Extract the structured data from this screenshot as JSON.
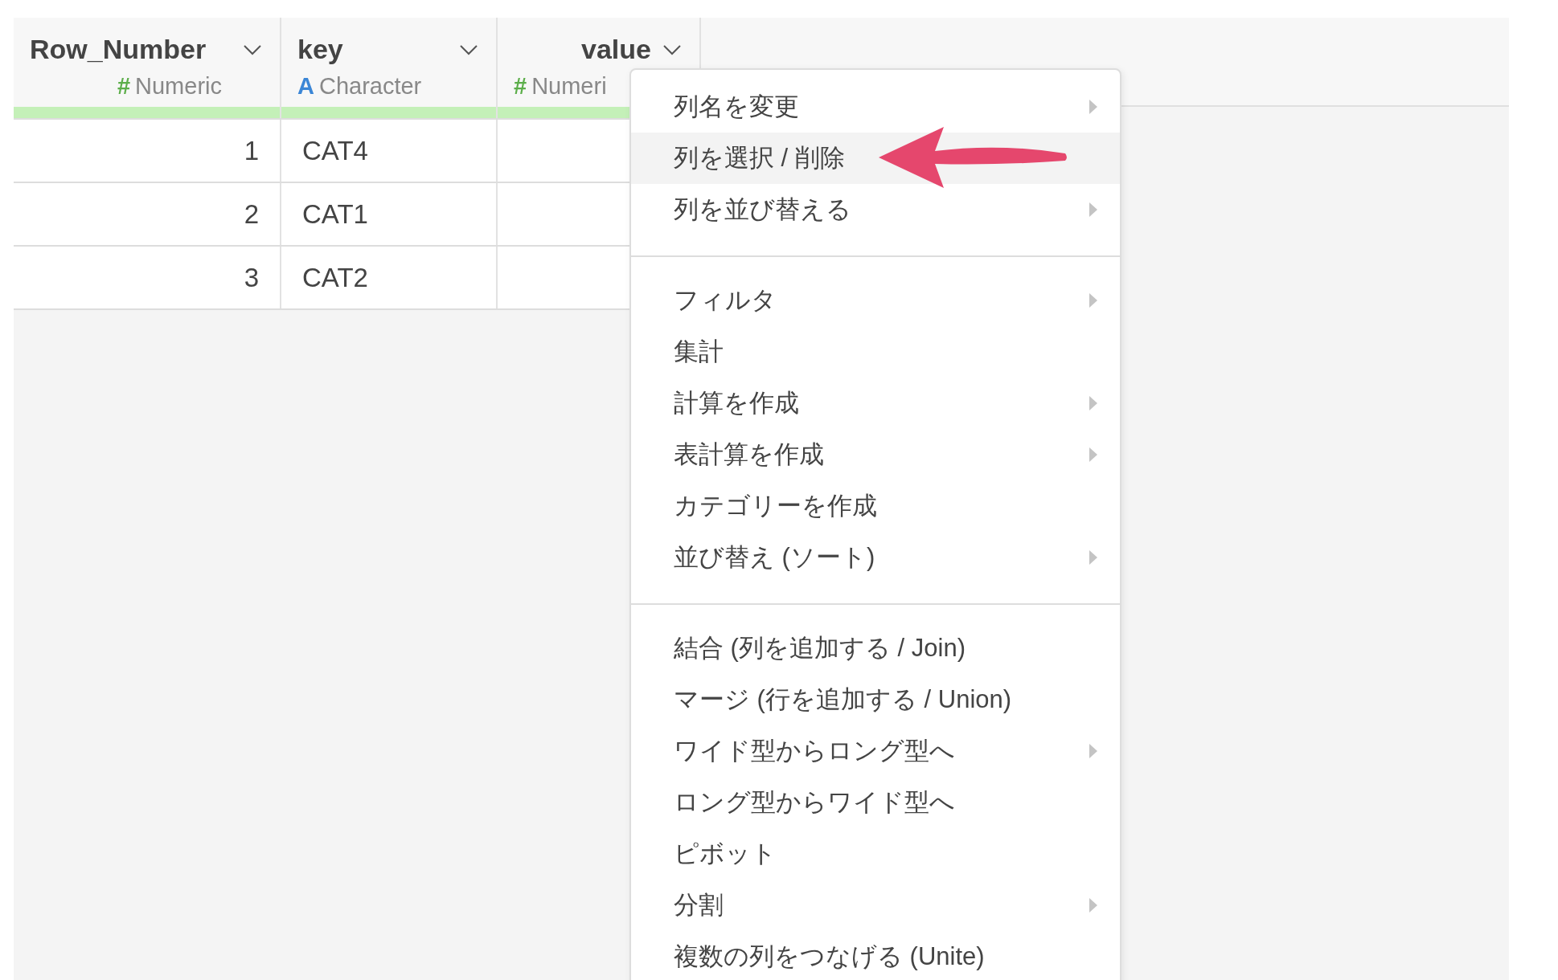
{
  "table": {
    "columns": [
      {
        "name": "Row_Number",
        "type_icon": "#",
        "type_label": "Numeric",
        "kind": "numeric"
      },
      {
        "name": "key",
        "type_icon": "A",
        "type_label": "Character",
        "kind": "character"
      },
      {
        "name": "value",
        "type_icon": "#",
        "type_label": "Numeri",
        "kind": "numeric"
      }
    ],
    "rows": [
      {
        "cells": [
          "1",
          "CAT4"
        ]
      },
      {
        "cells": [
          "2",
          "CAT1"
        ]
      },
      {
        "cells": [
          "3",
          "CAT2"
        ]
      }
    ]
  },
  "context_menu": {
    "groups": [
      {
        "items": [
          {
            "label": "列名を変更",
            "submenu": true,
            "selected": false
          },
          {
            "label": "列を選択 / 削除",
            "submenu": false,
            "selected": true
          },
          {
            "label": "列を並び替える",
            "submenu": true,
            "selected": false
          }
        ]
      },
      {
        "items": [
          {
            "label": "フィルタ",
            "submenu": true,
            "selected": false
          },
          {
            "label": "集計",
            "submenu": false,
            "selected": false
          },
          {
            "label": "計算を作成",
            "submenu": true,
            "selected": false
          },
          {
            "label": "表計算を作成",
            "submenu": true,
            "selected": false
          },
          {
            "label": "カテゴリーを作成",
            "submenu": false,
            "selected": false
          },
          {
            "label": "並び替え (ソート)",
            "submenu": true,
            "selected": false
          }
        ]
      },
      {
        "items": [
          {
            "label": "結合 (列を追加する / Join)",
            "submenu": false,
            "selected": false
          },
          {
            "label": "マージ (行を追加する / Union)",
            "submenu": false,
            "selected": false
          },
          {
            "label": "ワイド型からロング型へ",
            "submenu": true,
            "selected": false
          },
          {
            "label": "ロング型からワイド型へ",
            "submenu": false,
            "selected": false
          },
          {
            "label": "ピボット",
            "submenu": false,
            "selected": false
          },
          {
            "label": "分割",
            "submenu": true,
            "selected": false
          },
          {
            "label": "複数の列をつなげる (Unite)",
            "submenu": false,
            "selected": false
          }
        ]
      }
    ]
  }
}
